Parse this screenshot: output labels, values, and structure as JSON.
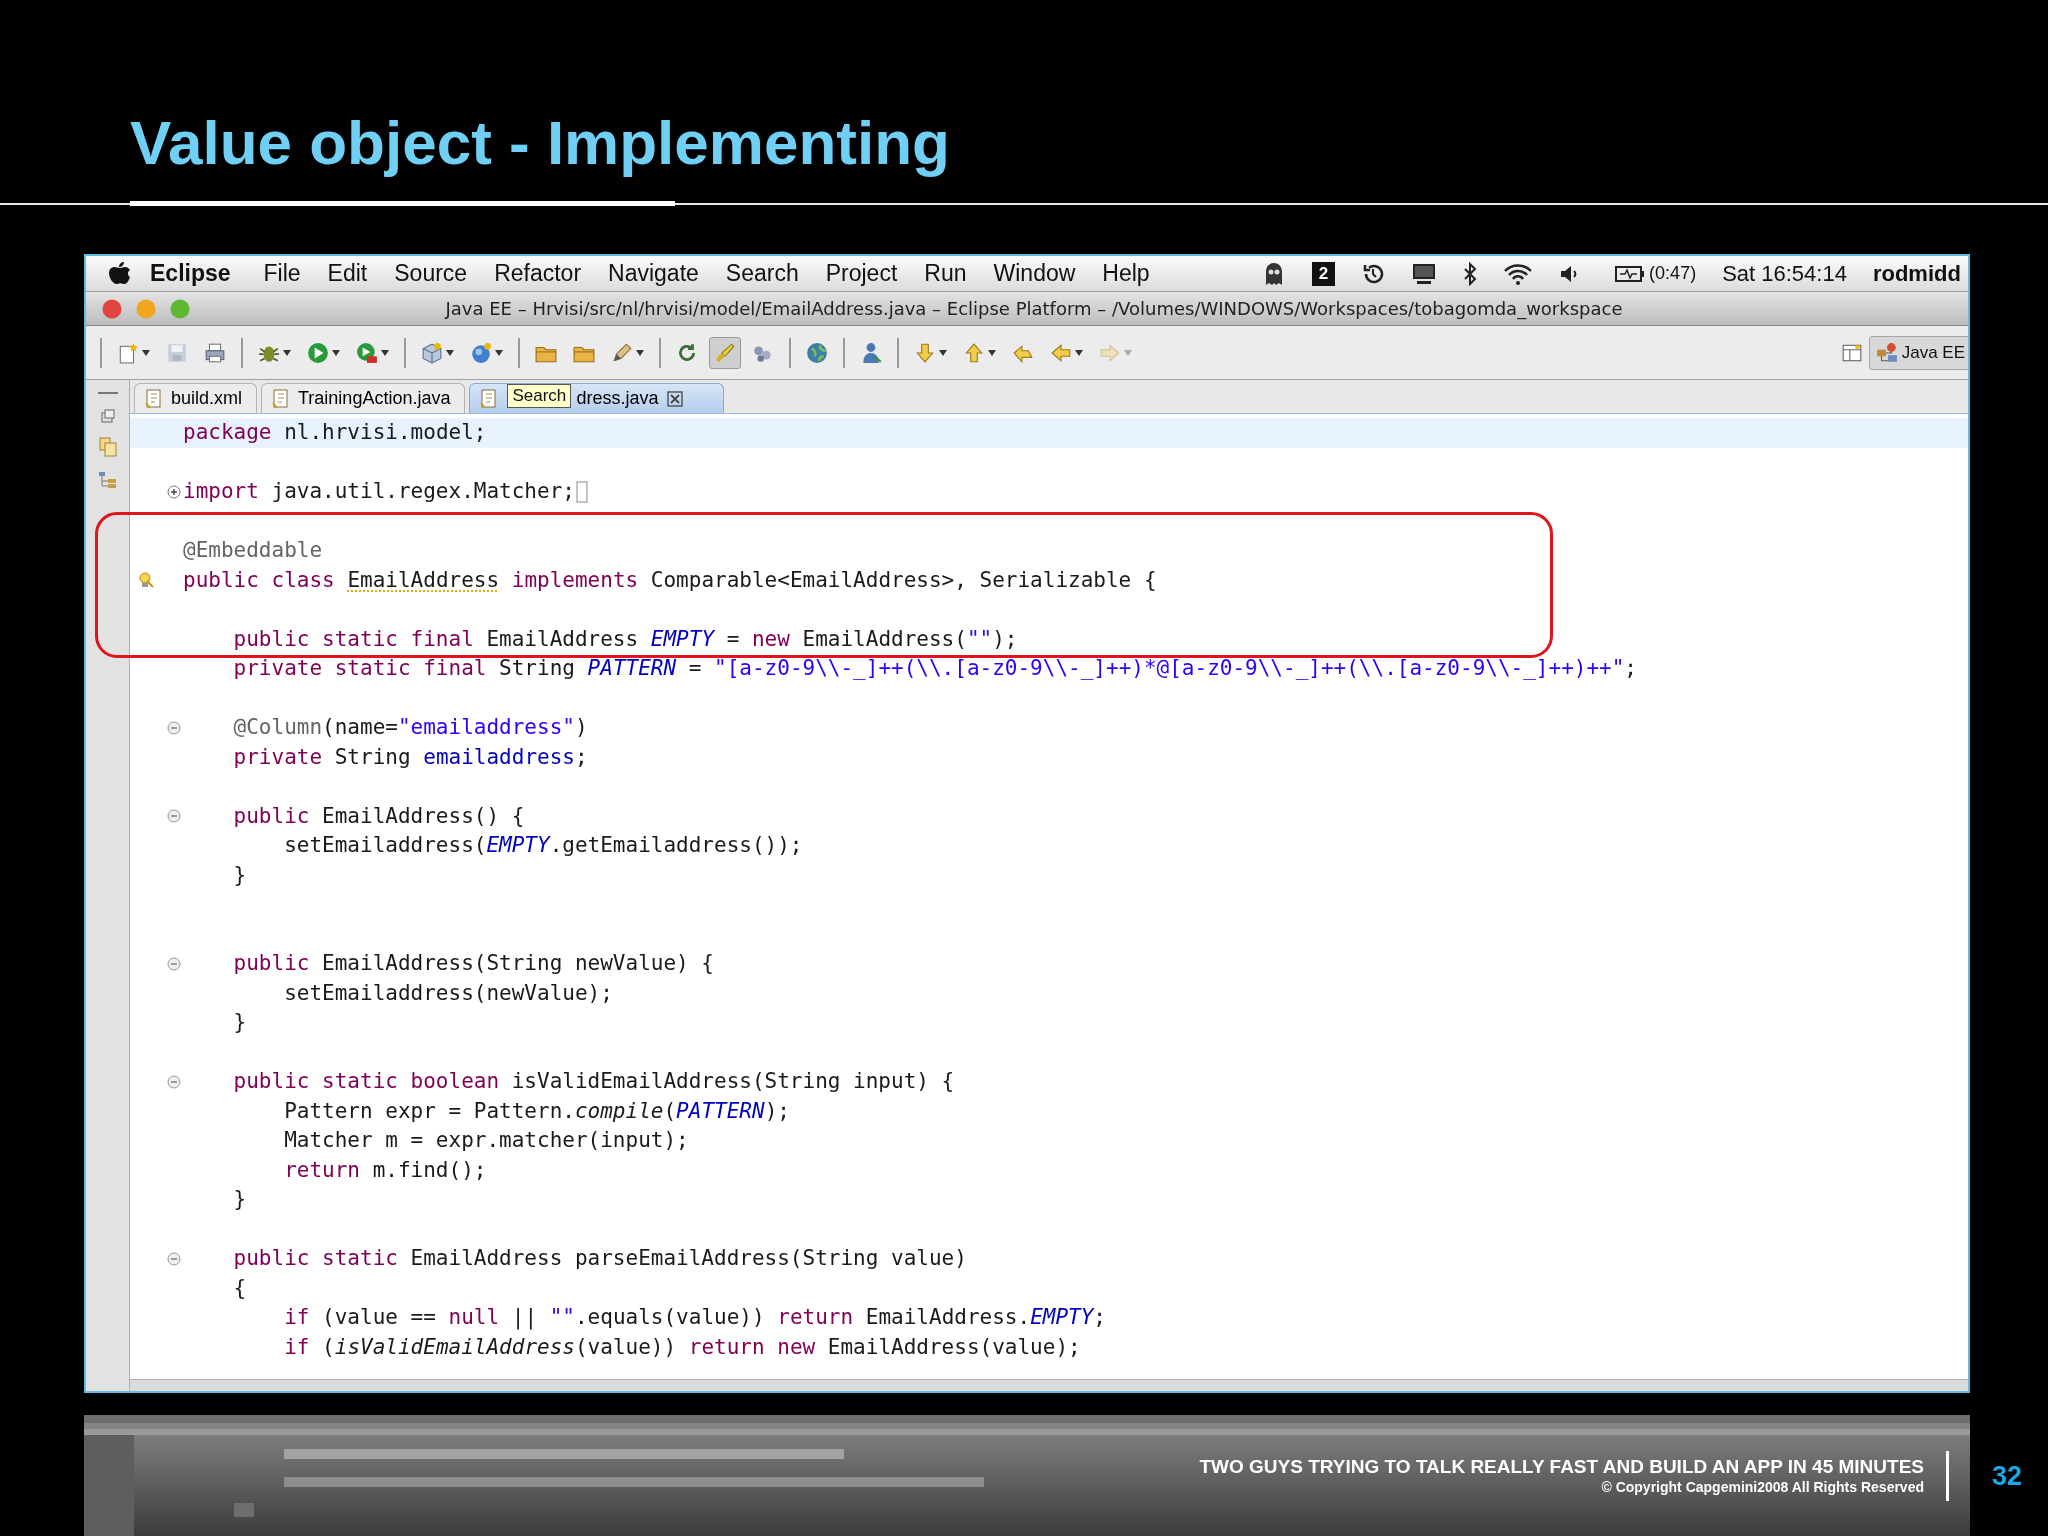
{
  "slide": {
    "title": "Value object - Implementing",
    "footer": {
      "tagline": "TWO GUYS TRYING TO TALK REALLY FAST AND BUILD AN APP IN 45 MINUTES",
      "copyright": "© Copyright Capgemini2008 All Rights Reserved",
      "page_number": "32"
    }
  },
  "menu_bar": {
    "app": "Eclipse",
    "items": [
      "File",
      "Edit",
      "Source",
      "Refactor",
      "Navigate",
      "Search",
      "Project",
      "Run",
      "Window",
      "Help"
    ],
    "status": [
      {
        "kind": "ghost"
      },
      {
        "kind": "badge",
        "text": "2"
      },
      {
        "kind": "history"
      },
      {
        "kind": "display"
      },
      {
        "kind": "bluetooth"
      },
      {
        "kind": "wifi"
      },
      {
        "kind": "volume"
      },
      {
        "kind": "battery",
        "text": "(0:47)"
      },
      {
        "kind": "clock",
        "text": "Sat 16:54:14"
      },
      {
        "kind": "user",
        "text": "rodmidd"
      }
    ]
  },
  "window": {
    "title": "Java EE – Hrvisi/src/nl/hrvisi/model/EmailAddress.java – Eclipse Platform – /Volumes/WINDOWS/Workspaces/tobagomda_workspace"
  },
  "toolbar": {
    "items": [
      {
        "kind": "separator"
      },
      {
        "kind": "page",
        "dropdown": true,
        "disabled": false,
        "pressed": false
      },
      {
        "kind": "save",
        "dropdown": false,
        "disabled": true,
        "pressed": false
      },
      {
        "kind": "printer",
        "dropdown": false,
        "disabled": false,
        "pressed": false
      },
      {
        "kind": "separator"
      },
      {
        "kind": "bug",
        "dropdown": true,
        "disabled": false,
        "pressed": false
      },
      {
        "kind": "play",
        "dropdown": true,
        "disabled": false,
        "pressed": false
      },
      {
        "kind": "play-tool",
        "dropdown": true,
        "disabled": false,
        "pressed": false
      },
      {
        "kind": "separator"
      },
      {
        "kind": "box",
        "dropdown": true,
        "disabled": false,
        "pressed": false
      },
      {
        "kind": "orb",
        "dropdown": true,
        "disabled": false,
        "pressed": false
      },
      {
        "kind": "separator"
      },
      {
        "kind": "folder",
        "dropdown": false,
        "disabled": false,
        "pressed": false
      },
      {
        "kind": "folder",
        "dropdown": false,
        "disabled": false,
        "pressed": false
      },
      {
        "kind": "pencil",
        "dropdown": true,
        "disabled": false,
        "pressed": false
      },
      {
        "kind": "separator"
      },
      {
        "kind": "refresh",
        "dropdown": false,
        "disabled": false,
        "pressed": false
      },
      {
        "kind": "brush",
        "dropdown": false,
        "disabled": false,
        "pressed": true
      },
      {
        "kind": "dots",
        "dropdown": false,
        "disabled": false,
        "pressed": false
      },
      {
        "kind": "separator"
      },
      {
        "kind": "globe",
        "dropdown": false,
        "disabled": false,
        "pressed": false
      },
      {
        "kind": "separator"
      },
      {
        "kind": "person",
        "dropdown": false,
        "disabled": false,
        "pressed": false
      },
      {
        "kind": "separator"
      },
      {
        "kind": "down-arrow",
        "dropdown": true,
        "disabled": false,
        "pressed": false
      },
      {
        "kind": "up-arrow",
        "dropdown": true,
        "disabled": false,
        "pressed": false
      },
      {
        "kind": "back-arrow",
        "dropdown": false,
        "disabled": false,
        "pressed": false
      },
      {
        "kind": "left-arrow",
        "dropdown": true,
        "disabled": false,
        "pressed": false
      },
      {
        "kind": "right-arrow",
        "dropdown": true,
        "disabled": true,
        "pressed": false
      }
    ],
    "perspective": "Java EE"
  },
  "tabs": [
    {
      "label": "build.xml",
      "selected": false
    },
    {
      "label": "TrainingAction.java",
      "selected": false
    },
    {
      "label": "dress.java",
      "selected": true
    }
  ],
  "tooltip": "Search",
  "editor": {
    "lines": [
      {
        "kind": "code",
        "current": true,
        "segments": [
          {
            "kind": "keyword",
            "text": "package"
          },
          {
            "kind": "plain",
            "text": " nl.hrvisi.model;"
          }
        ]
      },
      {
        "kind": "blank",
        "current": false
      },
      {
        "kind": "code",
        "current": false,
        "collapsed": true,
        "segments": [
          {
            "kind": "keyword",
            "text": "import"
          },
          {
            "kind": "plain",
            "text": " java.util.regex.Matcher;"
          }
        ]
      },
      {
        "kind": "blank",
        "current": false
      },
      {
        "kind": "code",
        "current": false,
        "highlighted": true,
        "segments": [
          {
            "kind": "annotation",
            "text": "@Embeddable"
          }
        ]
      },
      {
        "kind": "code",
        "current": false,
        "highlighted": true,
        "warning": true,
        "segments": [
          {
            "kind": "keyword",
            "text": "public class "
          },
          {
            "kind": "warned",
            "text": "EmailAddress"
          },
          {
            "kind": "keyword",
            "text": " implements"
          },
          {
            "kind": "plain",
            "text": " Comparable<EmailAddress>, Serializable {"
          }
        ]
      },
      {
        "kind": "blank",
        "current": false,
        "highlighted": true
      },
      {
        "kind": "code",
        "current": false,
        "highlighted": true,
        "segments": [
          {
            "kind": "keyword",
            "text": "    public static final"
          },
          {
            "kind": "plain",
            "text": " EmailAddress "
          },
          {
            "kind": "static",
            "text": "EMPTY"
          },
          {
            "kind": "plain",
            "text": " = "
          },
          {
            "kind": "keyword",
            "text": "new"
          },
          {
            "kind": "plain",
            "text": " EmailAddress("
          },
          {
            "kind": "string",
            "text": "\"\""
          },
          {
            "kind": "plain",
            "text": ");"
          }
        ]
      },
      {
        "kind": "code",
        "current": false,
        "segments": [
          {
            "kind": "keyword",
            "text": "    private static final"
          },
          {
            "kind": "plain",
            "text": " String "
          },
          {
            "kind": "static",
            "text": "PATTERN"
          },
          {
            "kind": "plain",
            "text": " = "
          },
          {
            "kind": "string",
            "text": "\"[a-z0-9\\\\-_]++(\\\\.[a-z0-9\\\\-_]++)*@[a-z0-9\\\\-_]++(\\\\.[a-z0-9\\\\-_]++)++\""
          },
          {
            "kind": "plain",
            "text": ";"
          }
        ]
      },
      {
        "kind": "blank",
        "current": false
      },
      {
        "kind": "code",
        "current": false,
        "collapsed": false,
        "segments": [
          {
            "kind": "annotation",
            "text": "    @Column"
          },
          {
            "kind": "plain",
            "text": "(name="
          },
          {
            "kind": "string",
            "text": "\"emailaddress\""
          },
          {
            "kind": "plain",
            "text": ")"
          }
        ]
      },
      {
        "kind": "code",
        "current": false,
        "segments": [
          {
            "kind": "keyword",
            "text": "    private"
          },
          {
            "kind": "plain",
            "text": " String "
          },
          {
            "kind": "field",
            "text": "emailaddress"
          },
          {
            "kind": "plain",
            "text": ";"
          }
        ]
      },
      {
        "kind": "blank",
        "current": false
      },
      {
        "kind": "code",
        "current": false,
        "collapsed": false,
        "segments": [
          {
            "kind": "keyword",
            "text": "    public"
          },
          {
            "kind": "plain",
            "text": " EmailAddress() {"
          }
        ]
      },
      {
        "kind": "code",
        "current": false,
        "segments": [
          {
            "kind": "plain",
            "text": "        setEmailaddress("
          },
          {
            "kind": "static",
            "text": "EMPTY"
          },
          {
            "kind": "plain",
            "text": ".getEmailaddress());"
          }
        ]
      },
      {
        "kind": "code",
        "current": false,
        "segments": [
          {
            "kind": "plain",
            "text": "    }"
          }
        ]
      },
      {
        "kind": "blank",
        "current": false
      },
      {
        "kind": "blank",
        "current": false
      },
      {
        "kind": "code",
        "current": false,
        "collapsed": false,
        "segments": [
          {
            "kind": "keyword",
            "text": "    public"
          },
          {
            "kind": "plain",
            "text": " EmailAddress(String newValue) {"
          }
        ]
      },
      {
        "kind": "code",
        "current": false,
        "segments": [
          {
            "kind": "plain",
            "text": "        setEmailaddress(newValue);"
          }
        ]
      },
      {
        "kind": "code",
        "current": false,
        "segments": [
          {
            "kind": "plain",
            "text": "    }"
          }
        ]
      },
      {
        "kind": "blank",
        "current": false
      },
      {
        "kind": "code",
        "current": false,
        "collapsed": false,
        "segments": [
          {
            "kind": "keyword",
            "text": "    public static boolean"
          },
          {
            "kind": "plain",
            "text": " isValidEmailAddress(String input) {"
          }
        ]
      },
      {
        "kind": "code",
        "current": false,
        "segments": [
          {
            "kind": "plain",
            "text": "        Pattern expr = Pattern."
          },
          {
            "kind": "call",
            "text": "compile"
          },
          {
            "kind": "plain",
            "text": "("
          },
          {
            "kind": "static",
            "text": "PATTERN"
          },
          {
            "kind": "plain",
            "text": ");"
          }
        ]
      },
      {
        "kind": "code",
        "current": false,
        "segments": [
          {
            "kind": "plain",
            "text": "        Matcher m = expr.matcher(input);"
          }
        ]
      },
      {
        "kind": "code",
        "current": false,
        "segments": [
          {
            "kind": "keyword",
            "text": "        return"
          },
          {
            "kind": "plain",
            "text": " m.find();"
          }
        ]
      },
      {
        "kind": "code",
        "current": false,
        "segments": [
          {
            "kind": "plain",
            "text": "    }"
          }
        ]
      },
      {
        "kind": "blank",
        "current": false
      },
      {
        "kind": "code",
        "current": false,
        "collapsed": false,
        "segments": [
          {
            "kind": "keyword",
            "text": "    public static"
          },
          {
            "kind": "plain",
            "text": " EmailAddress parseEmailAddress(String value)"
          }
        ]
      },
      {
        "kind": "code",
        "current": false,
        "segments": [
          {
            "kind": "plain",
            "text": "    {"
          }
        ]
      },
      {
        "kind": "code",
        "current": false,
        "segments": [
          {
            "kind": "keyword",
            "text": "        if"
          },
          {
            "kind": "plain",
            "text": " (value == "
          },
          {
            "kind": "keyword",
            "text": "null"
          },
          {
            "kind": "plain",
            "text": " || "
          },
          {
            "kind": "string",
            "text": "\"\""
          },
          {
            "kind": "plain",
            "text": ".equals(value)) "
          },
          {
            "kind": "keyword",
            "text": "return"
          },
          {
            "kind": "plain",
            "text": " EmailAddress."
          },
          {
            "kind": "static",
            "text": "EMPTY"
          },
          {
            "kind": "plain",
            "text": ";"
          }
        ]
      },
      {
        "kind": "code",
        "current": false,
        "segments": [
          {
            "kind": "keyword",
            "text": "        if"
          },
          {
            "kind": "plain",
            "text": " ("
          },
          {
            "kind": "call",
            "text": "isValidEmailAddress"
          },
          {
            "kind": "plain",
            "text": "(value)) "
          },
          {
            "kind": "keyword",
            "text": "return new"
          },
          {
            "kind": "plain",
            "text": " EmailAddress(value);"
          }
        ]
      }
    ]
  }
}
